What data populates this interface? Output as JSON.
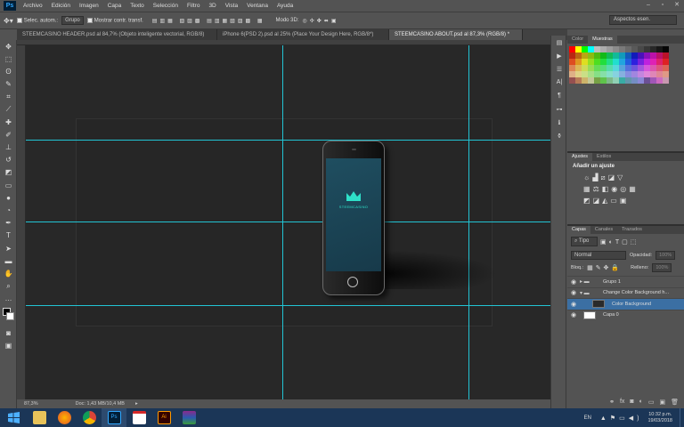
{
  "menubar": {
    "logo": "Ps",
    "items": [
      "Archivo",
      "Edición",
      "Imagen",
      "Capa",
      "Texto",
      "Selección",
      "Filtro",
      "3D",
      "Vista",
      "Ventana",
      "Ayuda"
    ]
  },
  "options": {
    "auto_select_label": "Selec. autom.:",
    "group_value": "Grupo",
    "transform_label": "Mostrar contr. transf.",
    "mode3d": "Modo 3D:",
    "workspace": "Aspectos esen."
  },
  "tabs": [
    "STEEMCASINO HEADER.psd al 84,7% (Objeto inteligente vectorial, RGB/8)",
    "iPhone 6(PSD 2).psd al 25% (Place Your Design Here, RGB/8*)",
    "STEEMCASINO ABOUT.psd al 87,3% (RGB/8) *"
  ],
  "status": {
    "zoom": "87,3%",
    "doc": "Doc: 1,43 MB/10,4 MB"
  },
  "phone": {
    "brand": "STEEMCASINO"
  },
  "panels": {
    "color_tabs": [
      "Color",
      "Muestras"
    ],
    "adjust_tabs": [
      "Ajustes",
      "Estilos"
    ],
    "adjust_title": "Añadir un ajuste",
    "layers_tabs": [
      "Capas",
      "Canales",
      "Trazados"
    ],
    "filter_kind": "Tipo",
    "blend_mode": "Normal",
    "opacity_label": "Opacidad:",
    "opacity_value": "100%",
    "lock_label": "Bloq.:",
    "fill_label": "Relleno:",
    "fill_value": "100%",
    "layers": [
      {
        "name": "Grupo 1",
        "type": "group",
        "visible": true,
        "selected": false
      },
      {
        "name": "Change Color Background h...",
        "type": "group-open",
        "visible": true,
        "selected": false
      },
      {
        "name": "Color Background",
        "type": "layer",
        "visible": true,
        "selected": true
      },
      {
        "name": "Capa 0",
        "type": "layer",
        "visible": true,
        "selected": false
      }
    ]
  },
  "taskbar": {
    "lang": "EN",
    "time": "10:32 p.m.",
    "date": "19/03/2018"
  }
}
